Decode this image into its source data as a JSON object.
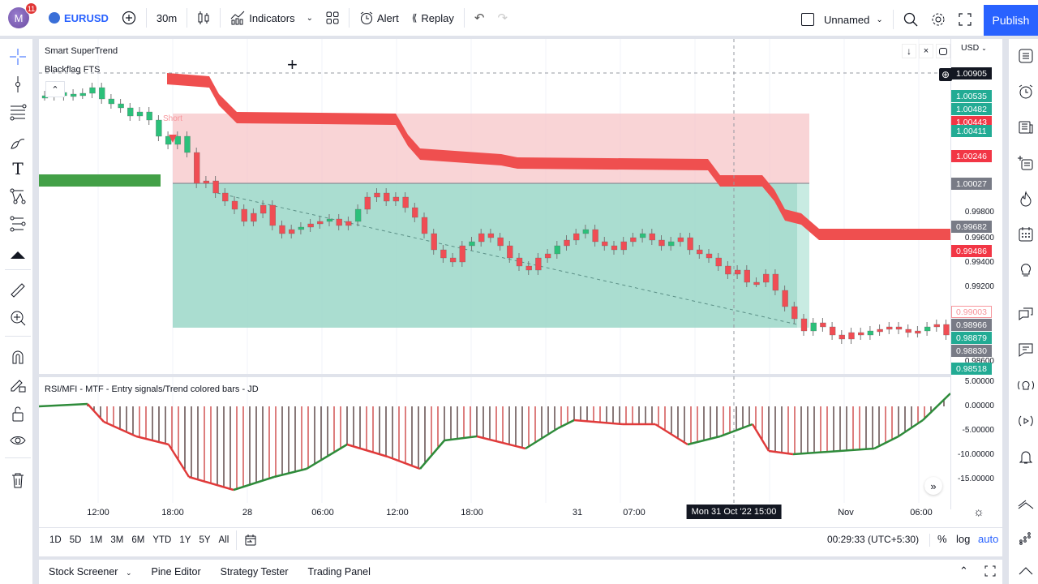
{
  "topbar": {
    "avatar_letter": "M",
    "notification_count": "11",
    "symbol": "EURUSD",
    "interval": "30m",
    "indicators_label": "Indicators",
    "alert_label": "Alert",
    "replay_label": "Replay",
    "layout_name": "Unnamed",
    "publish_label": "Publish"
  },
  "chart": {
    "indicator_1": "Smart SuperTrend",
    "indicator_2": "Blackflag FTS",
    "short_label": "Short",
    "currency": "USD",
    "pane2_title": "RSI/MFI - MTF - Entry signals/Trend colored bars - JD",
    "price_labels": [
      "0.99800",
      "0.99600",
      "0.99400",
      "0.99200",
      "0.98600"
    ],
    "price_tags": [
      {
        "value": "1.00905",
        "color": "#131722"
      },
      {
        "value": "1.00535",
        "color": "#22ab94"
      },
      {
        "value": "1.00482",
        "color": "#22ab94"
      },
      {
        "value": "1.00443",
        "color": "#f23645"
      },
      {
        "value": "1.00411",
        "color": "#22ab94"
      },
      {
        "value": "1.00246",
        "color": "#f23645"
      },
      {
        "value": "1.00027",
        "color": "#787b86"
      },
      {
        "value": "0.99682",
        "color": "#787b86"
      },
      {
        "value": "0.99486",
        "color": "#f23645"
      },
      {
        "value": "0.99003",
        "color": "#ffffff"
      },
      {
        "value": "0.98966",
        "color": "#787b86"
      },
      {
        "value": "0.98879",
        "color": "#22ab94"
      },
      {
        "value": "0.98830",
        "color": "#787b86"
      },
      {
        "value": "0.98518",
        "color": "#22ab94"
      }
    ],
    "osc_labels": [
      "5.00000",
      "0.00000",
      "-5.00000",
      "-10.00000",
      "-15.00000"
    ],
    "time_labels": [
      "12:00",
      "18:00",
      "28",
      "06:00",
      "12:00",
      "18:00",
      "31",
      "07:00",
      "Nov",
      "06:00"
    ],
    "crosshair_time": "Mon 31 Oct '22   15:00"
  },
  "bottom": {
    "ranges": [
      "1D",
      "5D",
      "1M",
      "3M",
      "6M",
      "YTD",
      "1Y",
      "5Y",
      "All"
    ],
    "clock": "00:29:33 (UTC+5:30)",
    "percent_label": "%",
    "log_label": "log",
    "auto_label": "auto"
  },
  "panel": {
    "tabs": [
      "Stock Screener",
      "Pine Editor",
      "Strategy Tester",
      "Trading Panel"
    ]
  }
}
